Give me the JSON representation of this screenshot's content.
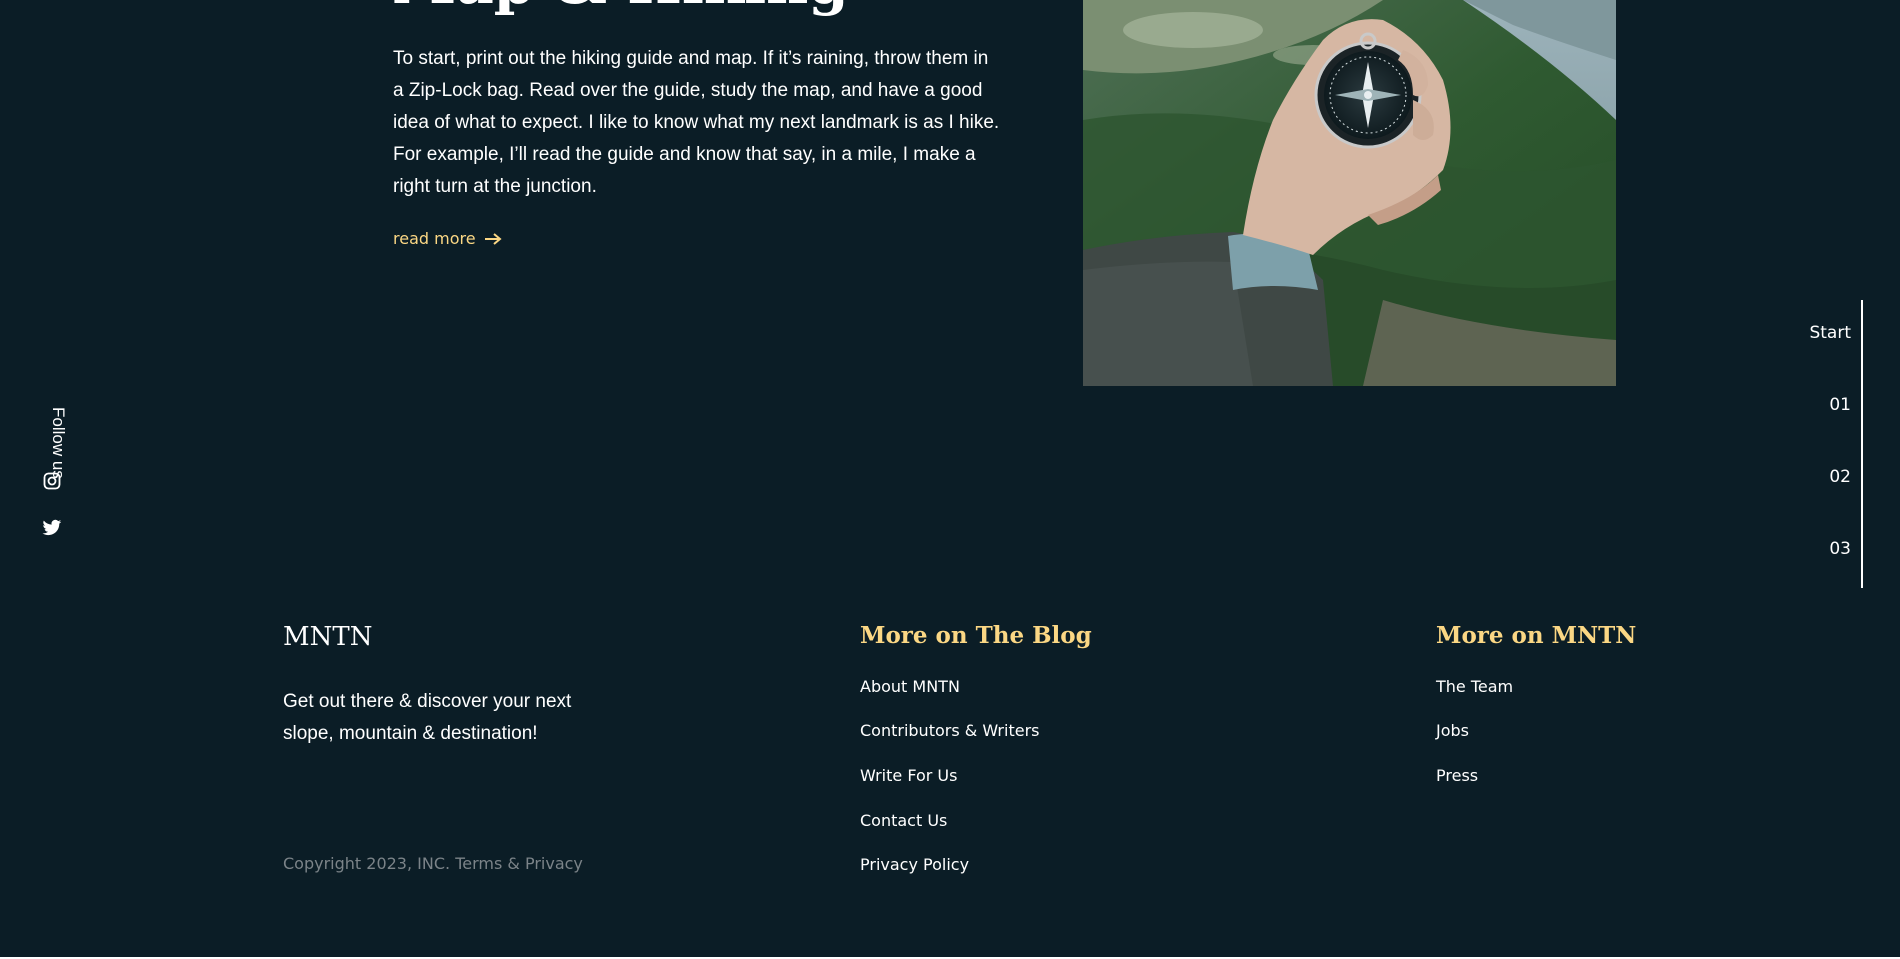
{
  "article": {
    "heading": "Map & Hiking",
    "body": "To start, print out the hiking guide and map. If it’s raining, throw them in a Zip-Lock bag. Read over the guide, study the map, and have a good idea of what to expect. I like to know what my next landmark is as I hike. For example, I’ll read the guide and know that say, in a mile, I make a right turn at the junction.",
    "read_more_label": "read more",
    "read_more_icon": "arrow-right-icon",
    "photo_subject": "compass-in-hand"
  },
  "social": {
    "label": "Follow us",
    "icons": [
      "instagram-icon",
      "twitter-icon"
    ]
  },
  "slider_nav": {
    "items": [
      "Start",
      "01",
      "02",
      "03"
    ]
  },
  "footer": {
    "brand": "MNTN",
    "tagline": "Get out there & discover your next slope, mountain & destination!",
    "copyright": "Copyright 2023, INC. Terms & Privacy",
    "columns": [
      {
        "heading": "More on The Blog",
        "links": [
          "About MNTN",
          "Contributors & Writers",
          "Write For Us",
          "Contact Us",
          "Privacy Policy"
        ]
      },
      {
        "heading": "More on MNTN",
        "links": [
          "The Team",
          "Jobs",
          "Press"
        ]
      }
    ]
  },
  "colors": {
    "background": "#0b1d26",
    "accent": "#fbd784",
    "text": "#ffffff",
    "muted": "#7b8388"
  }
}
